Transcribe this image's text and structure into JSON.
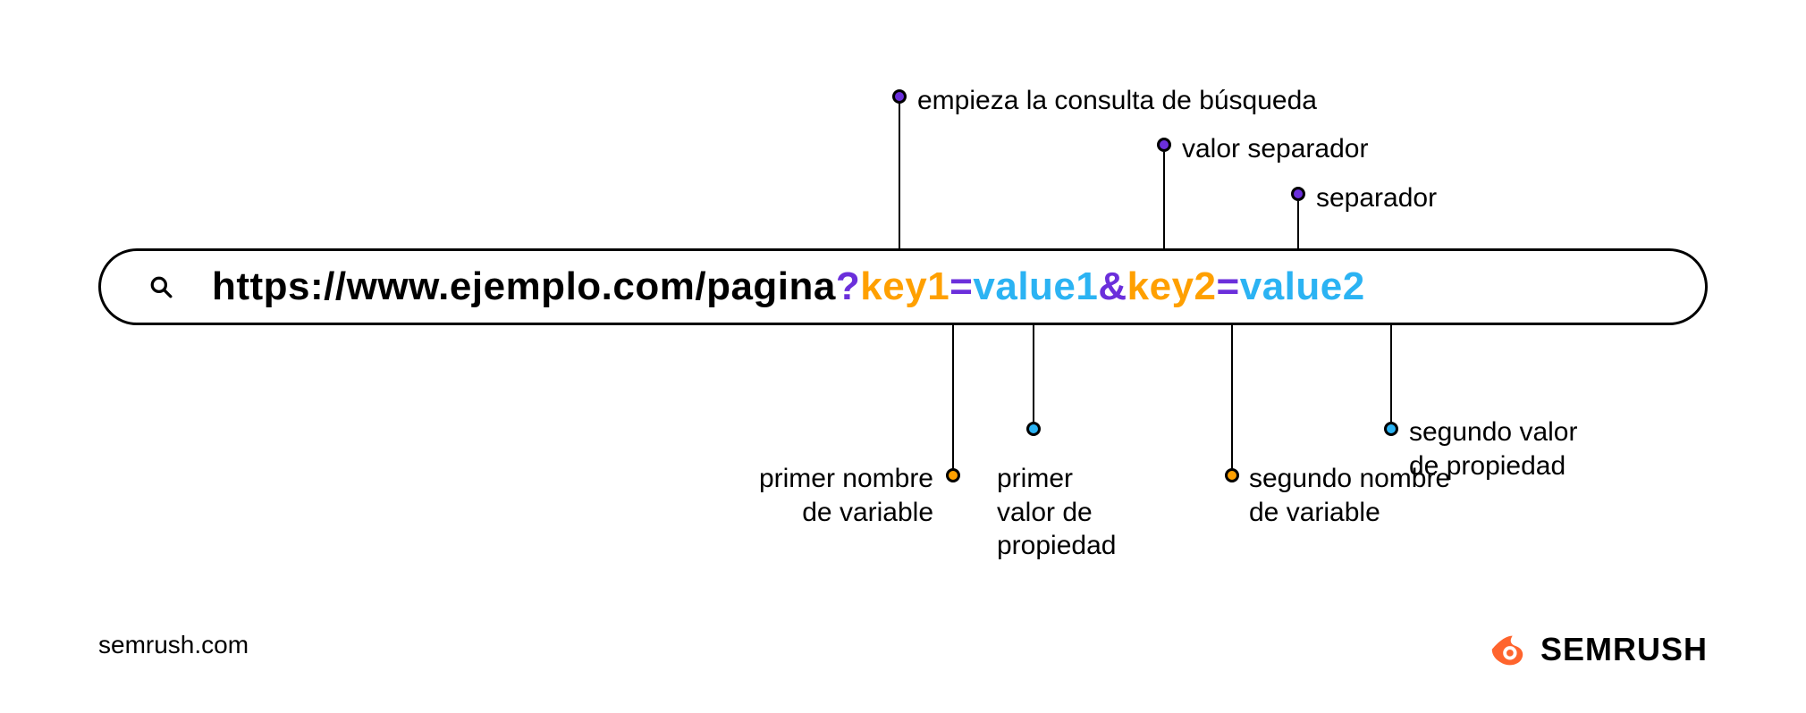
{
  "colors": {
    "purple": "#6B2FDB",
    "orange": "#FFA000",
    "blue": "#2BB3F3",
    "black": "#000000"
  },
  "url": {
    "base": "https://www.ejemplo.com/pagina",
    "qmark": "?",
    "key1": "key1",
    "eq1": "=",
    "val1": "value1",
    "amp": "&",
    "key2": "key2",
    "eq2": "=",
    "val2": "value2"
  },
  "annotations": {
    "query_start": "empieza la consulta de búsqueda",
    "value_separator": "valor separador",
    "separator": "separador",
    "first_var_name_l1": "primer nombre",
    "first_var_name_l2": "de variable",
    "first_prop_val_l1": "primer",
    "first_prop_val_l2": "valor de",
    "first_prop_val_l3": "propiedad",
    "second_var_name_l1": "segundo nombre",
    "second_var_name_l2": "de variable",
    "second_prop_val_l1": "segundo valor",
    "second_prop_val_l2": "de propiedad"
  },
  "footer": {
    "site": "semrush.com",
    "brand": "SEMRUSH"
  }
}
